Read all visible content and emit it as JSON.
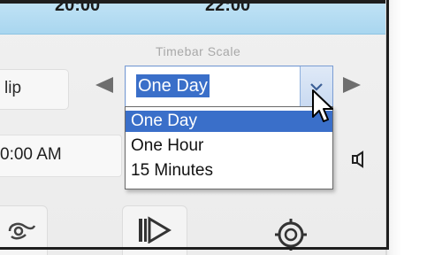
{
  "timeline": {
    "left_time": "20:00",
    "right_time": "22:00"
  },
  "timebar_scale": {
    "label": "Timebar Scale",
    "selected_value": "One Day",
    "options": [
      "One Day",
      "One Hour",
      "15 Minutes"
    ],
    "highlighted_option_index": 0
  },
  "toolbar": {
    "clip_label": "lip",
    "time_value": "0:00 AM"
  },
  "icons": {
    "prev": "left-arrow-icon",
    "next": "right-arrow-icon",
    "dropdown": "chevron-down-icon",
    "speaker": "speaker-icon",
    "transport": "play-step-icon",
    "target": "target-icon",
    "link": "link-icon",
    "cursor": "mouse-pointer-icon"
  },
  "colors": {
    "selection": "#3a6fc9",
    "timeline": "#b6ddf3"
  }
}
